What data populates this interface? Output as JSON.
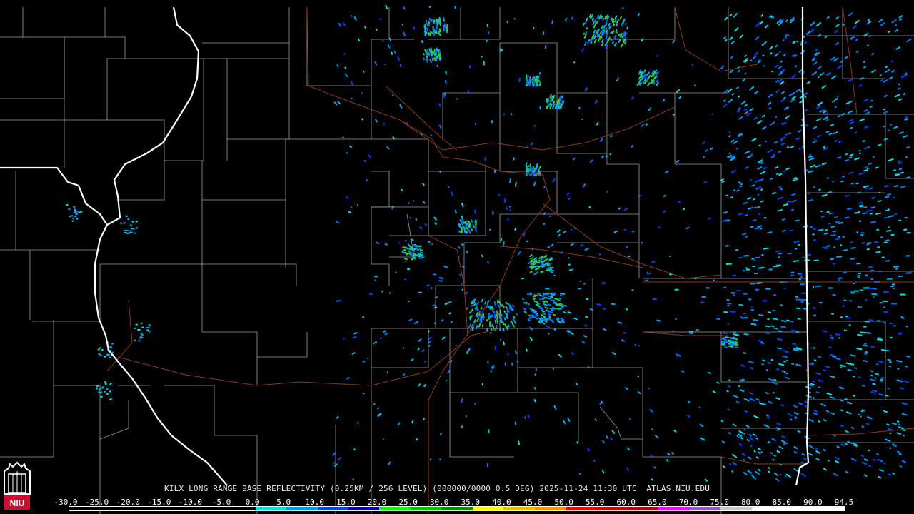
{
  "radar": {
    "station": "KILX",
    "caption": "KILX LONG RANGE BASE REFLECTIVITY (0.25KM / 256 LEVEL) (000000/0000 0.5 DEG) 2025-11-24 11:30 UTC  ATLAS.NIU.EDU",
    "logo_text": "NIU"
  },
  "legend": {
    "labels": [
      "-30.0",
      "-25.0",
      "-20.0",
      "-15.0",
      "-10.0",
      "-5.0",
      "0.0",
      "5.0",
      "10.0",
      "15.0",
      "20.0",
      "25.0",
      "30.0",
      "35.0",
      "40.0",
      "45.0",
      "50.0",
      "55.0",
      "60.0",
      "65.0",
      "70.0",
      "75.0",
      "80.0",
      "85.0",
      "90.0",
      "94.5"
    ],
    "colors": [
      "#000000",
      "#000000",
      "#000000",
      "#000000",
      "#000000",
      "#000000",
      "#00e0e0",
      "#009cf0",
      "#0040ff",
      "#0000c8",
      "#00ff00",
      "#00c800",
      "#009000",
      "#ffff00",
      "#e8c000",
      "#ff9000",
      "#ff0000",
      "#d60000",
      "#c00000",
      "#ff00ff",
      "#9955c9",
      "#c8c8c8",
      "#ffffff",
      "#ffffff",
      "#ffffff"
    ]
  },
  "colors": {
    "background": "#000000",
    "county_lines": "#9a9a9a",
    "state_lines": "#ffffff",
    "highways": "#8b3a1e"
  }
}
